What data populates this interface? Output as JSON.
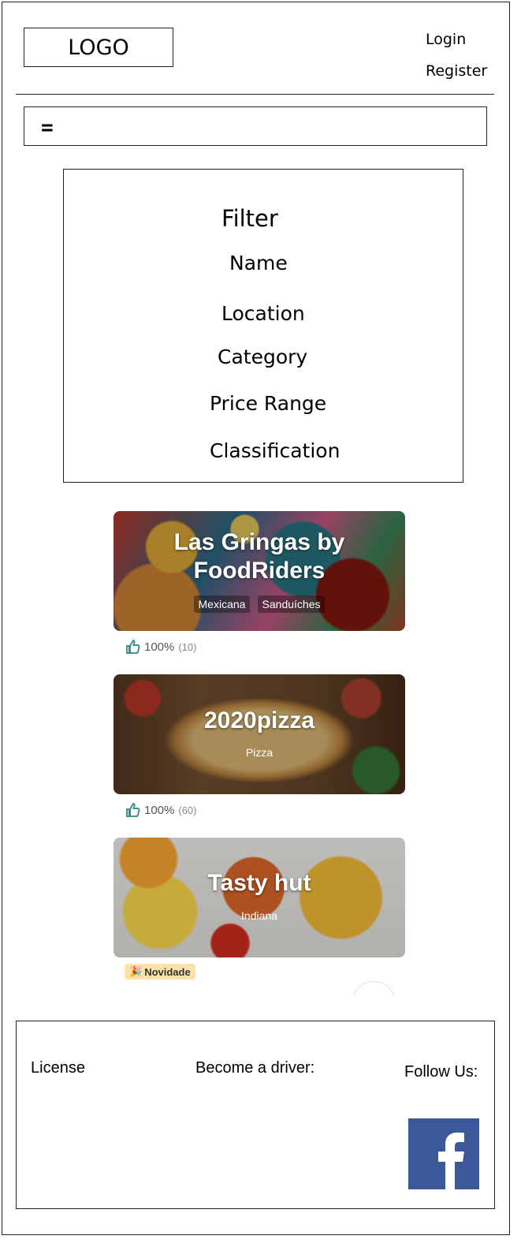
{
  "header": {
    "logo": "LOGO",
    "login": "Login",
    "register": "Register",
    "menu_icon": "="
  },
  "filter": {
    "title": "Filter",
    "options": [
      "Name",
      "Location",
      "Category",
      "Price Range",
      "Classification"
    ]
  },
  "restaurants": [
    {
      "name_line1": "Las Gringas by",
      "name_line2": "FoodRiders",
      "tags": [
        "Mexicana",
        "Sanduíches"
      ],
      "rating": "100%",
      "rating_count": "(10)"
    },
    {
      "name_line1": "2020pizza",
      "tags": [
        "Pizza"
      ],
      "rating": "100%",
      "rating_count": "(60)"
    },
    {
      "name_line1": "Tasty hut",
      "tags": [
        "Indiana"
      ],
      "badge": "Novidade"
    }
  ],
  "footer": {
    "license": "License",
    "driver": "Become a driver:",
    "follow": "Follow Us:",
    "social_icon": "facebook-icon"
  },
  "colors": {
    "facebook": "#3b5998",
    "badge_bg": "#fde2a7",
    "rating_icon": "#2a8a80"
  }
}
